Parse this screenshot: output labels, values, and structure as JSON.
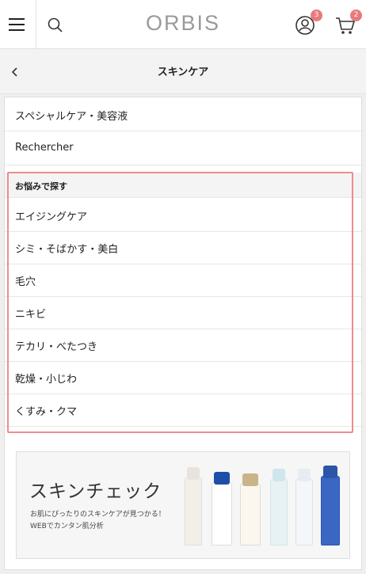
{
  "header": {
    "logo": "ORBIS",
    "account_badge": "3",
    "cart_badge": "2",
    "icons": [
      "menu-icon",
      "search-icon",
      "account-icon",
      "cart-icon"
    ]
  },
  "subheader": {
    "back_icon": "chevron-left-icon",
    "title": "スキンケア"
  },
  "menu": {
    "items": [
      "スペシャルケア・美容液",
      "Rechercher"
    ],
    "section_title": "お悩みで探す",
    "section_items": [
      "エイジングケア",
      "シミ・そばかす・美白",
      "毛穴",
      "ニキビ",
      "テカリ・べたつき",
      "乾燥・小じわ",
      "くすみ・クマ"
    ]
  },
  "banner": {
    "title": "スキンチェック",
    "line1": "お肌にぴったりのスキンケアが見つかる！",
    "line2": "WEBでカンタン肌分析"
  },
  "colors": {
    "badge": "#e87a7a",
    "highlight_border": "#ef8c8c",
    "logo": "#9a9a9a"
  }
}
